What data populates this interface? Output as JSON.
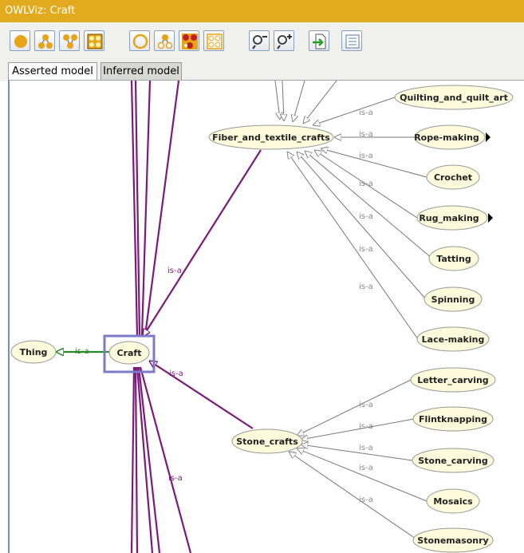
{
  "window": {
    "title": "OWLViz: Craft"
  },
  "toolbar": {
    "buttons": [
      {
        "icon": "show-class-icon"
      },
      {
        "icon": "show-subclasses-icon"
      },
      {
        "icon": "show-superclasses-icon"
      },
      {
        "icon": "show-all-icon"
      },
      {
        "icon": "hide-class-icon"
      },
      {
        "icon": "hide-subclasses-icon"
      },
      {
        "icon": "hide-superclasses-icon"
      },
      {
        "icon": "hide-all-icon"
      },
      {
        "icon": "zoom-out-icon"
      },
      {
        "icon": "zoom-in-icon"
      },
      {
        "icon": "export-icon"
      },
      {
        "icon": "options-icon"
      }
    ]
  },
  "tabs": [
    {
      "label": "Asserted model",
      "active": true
    },
    {
      "label": "Inferred model",
      "active": false
    }
  ],
  "graph": {
    "edge_label": "is-a",
    "nodes": {
      "thing": "Thing",
      "craft": "Craft",
      "fiber": "Fiber_and_textile_crafts",
      "stone": "Stone_crafts",
      "quilting": "Quilting_and_quilt_art",
      "rope": "Rope-making",
      "crochet": "Crochet",
      "rug": "Rug_making",
      "tatting": "Tatting",
      "spinning": "Spinning",
      "lace": "Lace-making",
      "letter": "Letter_carving",
      "flint": "Flintknapping",
      "stonecarving": "Stone_carving",
      "mosaics": "Mosaics",
      "masonry": "Stonemasonry"
    }
  },
  "colors": {
    "title_bar": "#e2ab1e",
    "node_fill": "#fdfbdc",
    "subclass_edge": "#7a1a7a",
    "superclass_edge": "#2a8a2a",
    "selection": "#7b7bc8"
  }
}
